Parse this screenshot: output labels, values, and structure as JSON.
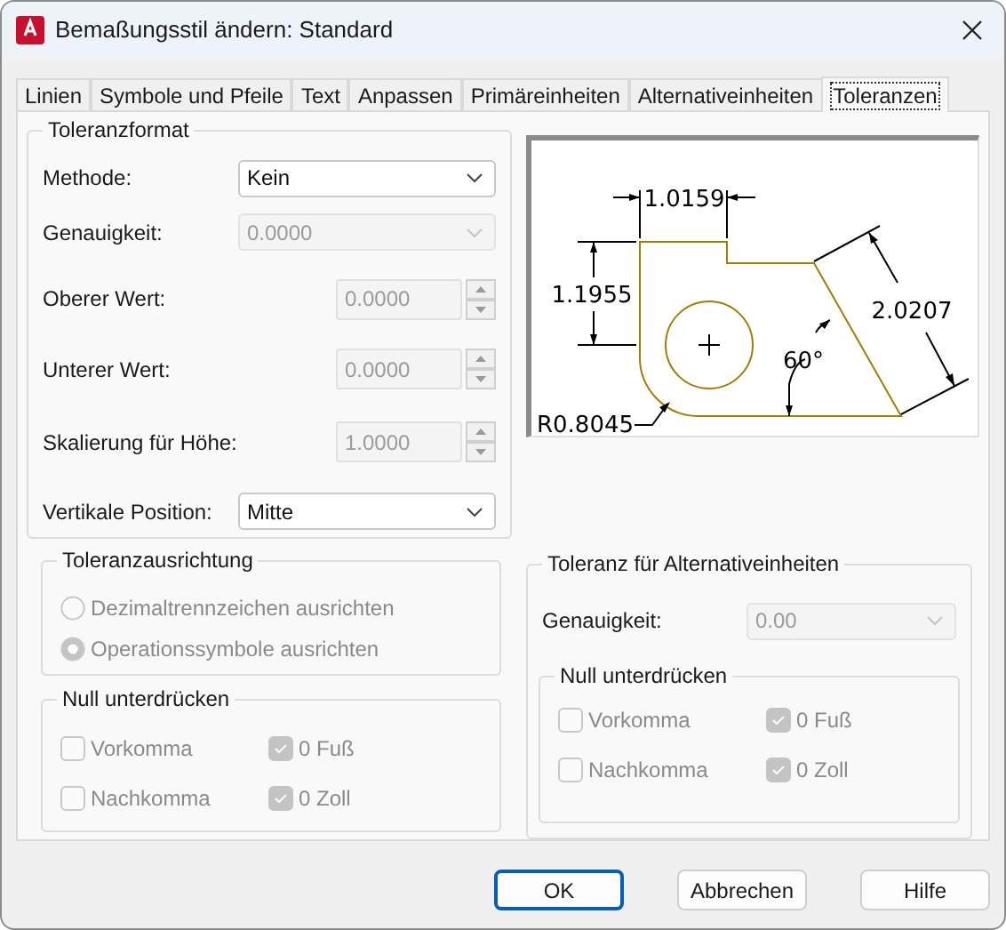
{
  "window": {
    "title": "Bemaßungsstil ändern: Standard"
  },
  "tabs": [
    {
      "label": "Linien",
      "selected": false
    },
    {
      "label": "Symbole und Pfeile",
      "selected": false
    },
    {
      "label": "Text",
      "selected": false
    },
    {
      "label": "Anpassen",
      "selected": false
    },
    {
      "label": "Primäreinheiten",
      "selected": false
    },
    {
      "label": "Alternativeinheiten",
      "selected": false
    },
    {
      "label": "Toleranzen",
      "selected": true
    }
  ],
  "tolerance_format": {
    "title": "Toleranzformat",
    "fields": [
      {
        "kind": "select",
        "label": "Methode:",
        "value": "Kein",
        "disabled": false
      },
      {
        "kind": "select",
        "label": "Genauigkeit:",
        "value": "0.0000",
        "disabled": true
      },
      {
        "kind": "spinner",
        "label": "Oberer Wert:",
        "value": "0.0000",
        "disabled": true
      },
      {
        "kind": "spinner",
        "label": "Unterer Wert:",
        "value": "0.0000",
        "disabled": true
      },
      {
        "kind": "spinner",
        "label": "Skalierung für Höhe:",
        "value": "1.0000",
        "disabled": true
      },
      {
        "kind": "select",
        "label": "Vertikale Position:",
        "value": "Mitte",
        "disabled": false
      }
    ]
  },
  "preview": {
    "labels": [
      "1.0159",
      "1.1955",
      "2.0207",
      "60°",
      "R0.8045"
    ]
  },
  "alignment": {
    "title": "Toleranzausrichtung",
    "options": [
      {
        "label": "Dezimaltrennzeichen ausrichten",
        "selected": false,
        "disabled": true
      },
      {
        "label": "Operationssymbole ausrichten",
        "selected": true,
        "disabled": true
      }
    ]
  },
  "zero_suppression": {
    "title": "Null unterdrücken",
    "checkboxes": [
      {
        "label": "Vorkomma",
        "checked": false,
        "disabled": true
      },
      {
        "label": "0 Fuß",
        "checked": true,
        "disabled": true
      },
      {
        "label": "Nachkomma",
        "checked": false,
        "disabled": true
      },
      {
        "label": "0 Zoll",
        "checked": true,
        "disabled": true
      }
    ]
  },
  "alternate": {
    "title": "Toleranz für Alternativeinheiten",
    "precision": {
      "label": "Genauigkeit:",
      "value": "0.00",
      "disabled": true
    },
    "zero_suppression": {
      "title": "Null unterdrücken",
      "checkboxes": [
        {
          "label": "Vorkomma",
          "checked": false,
          "disabled": true
        },
        {
          "label": "0 Fuß",
          "checked": true,
          "disabled": true
        },
        {
          "label": "Nachkomma",
          "checked": false,
          "disabled": true
        },
        {
          "label": "0 Zoll",
          "checked": true,
          "disabled": true
        }
      ]
    }
  },
  "buttons": [
    {
      "label": "OK",
      "default": true
    },
    {
      "label": "Abbrechen",
      "default": false
    },
    {
      "label": "Hilfe",
      "default": false
    }
  ]
}
